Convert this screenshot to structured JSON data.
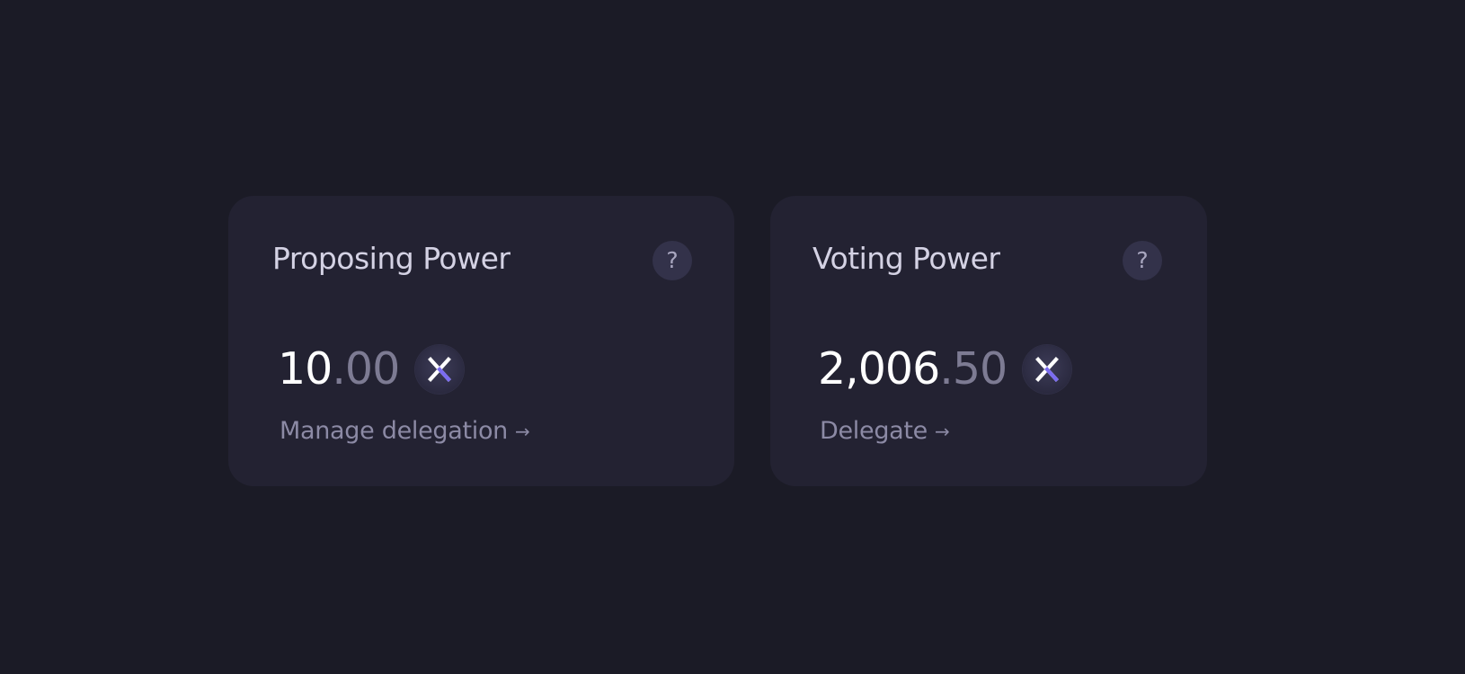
{
  "cards": [
    {
      "title": "Proposing Power",
      "help_label": "?",
      "amount_int": "10",
      "amount_frac": ".00",
      "token_icon": "x-token-icon",
      "link_label": "Manage delegation",
      "link_arrow": "→"
    },
    {
      "title": "Voting Power",
      "help_label": "?",
      "amount_int": "2,006",
      "amount_frac": ".50",
      "token_icon": "x-token-icon",
      "link_label": "Delegate",
      "link_arrow": "→"
    }
  ],
  "colors": {
    "background": "#1b1b26",
    "card": "#232232",
    "amount_int": "#ffffff",
    "amount_frac": "#7d7b93",
    "token_accent": "#7b6cf0"
  }
}
